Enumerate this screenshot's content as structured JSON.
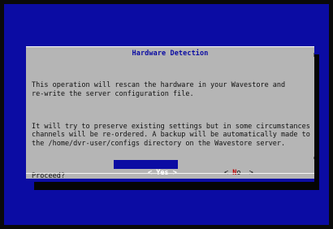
{
  "dialog": {
    "title": "Hardware Detection",
    "paragraphs": [
      "This operation will rescan the hardware in your Wavestore and\nre-write the server configuration file.",
      "It will try to preserve existing settings but in some circumstances\nchannels will be re-ordered. A backup will be automatically made to\nthe /home/dvr-user/configs directory on the Wavestore server.",
      "Proceed?"
    ],
    "buttons": {
      "yes": {
        "left": "< ",
        "hot": "Y",
        "rest": "es",
        "right": " >"
      },
      "no": {
        "left": "< ",
        "hot": "N",
        "rest": "o",
        "right": "  >"
      }
    }
  },
  "colors": {
    "background": "#0b0ca3",
    "dialog": "#b5b5b5",
    "title": "#0b0ca3",
    "selected_button_bg": "#0b0ca3",
    "hotkey": "#c00000"
  }
}
